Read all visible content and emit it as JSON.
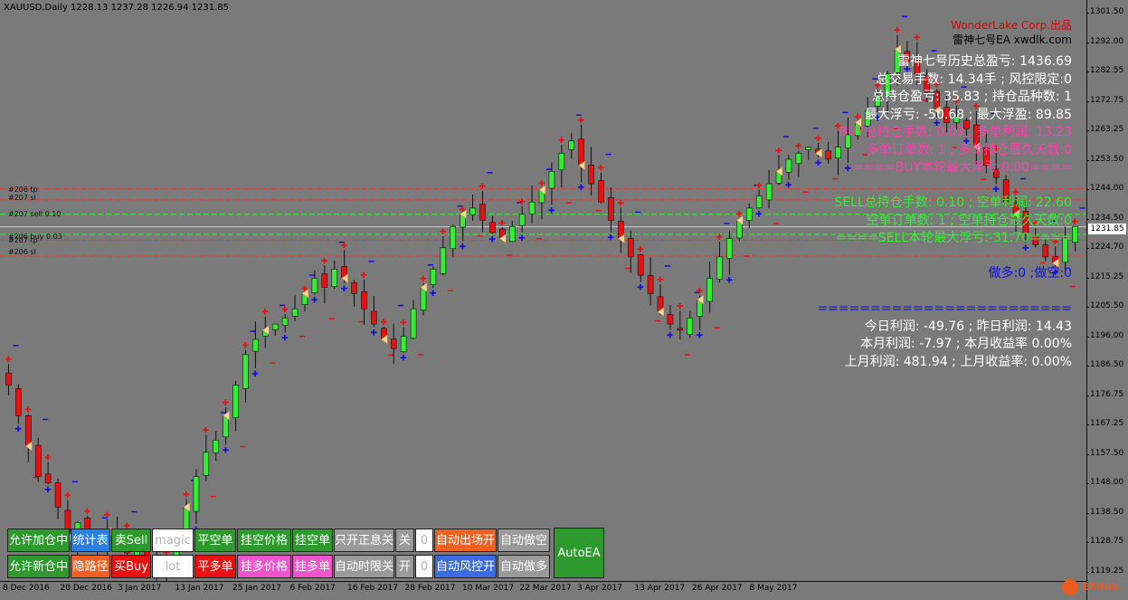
{
  "header": {
    "symbol_label": "XAUUSD,Daily",
    "ohlc": "1228.13 1237.28 1226.94 1231.85"
  },
  "brand": {
    "line1": "WonderLake Corp.出品",
    "line2": "雷神七号EA xwdlk.com"
  },
  "info_lines": [
    {
      "text": "雷神七号历史总盈亏: 1436.69",
      "color": "#ffffff"
    },
    {
      "text": "总交易手数: 14.34手 ; 风控限定:0",
      "color": "#ffffff"
    },
    {
      "text": "总持仓盈亏: 35.83 ; 持仓品种数: 1",
      "color": "#ffffff"
    },
    {
      "text": "最大浮亏: -50.68 ; 最大浮盈: 89.85",
      "color": "#ffffff"
    },
    {
      "text": "BUY总持仓手数: 0.03 ; 多单利润: 13.23",
      "color": "#ff3fb0"
    },
    {
      "text": "多单订单数: 1 ; 多单持仓最久天数:0",
      "color": "#ff3fb0"
    },
    {
      "text": "====BUY本轮最大浮亏:0.00====",
      "color": "#ff3fb0"
    },
    {
      "text": "",
      "color": "#ffffff"
    },
    {
      "text": "SELL总持仓手数: 0.10 ; 空单利润: 22.60",
      "color": "#33ee33"
    },
    {
      "text": "空单订单数: 1 ; 空单持仓最久天数:0",
      "color": "#33ee33"
    },
    {
      "text": "====SELL本轮最大浮亏:-31.70====",
      "color": "#33ee33"
    },
    {
      "text": "",
      "color": "#ffffff"
    },
    {
      "text": "做多:0 ;做空:0",
      "color": "#1010e0"
    },
    {
      "text": "",
      "color": "#ffffff"
    },
    {
      "text": "========================",
      "color": "#1010e0"
    },
    {
      "text": "今日利润: -49.76 ; 昨日利润: 14.43",
      "color": "#ffffff"
    },
    {
      "text": "本月利润: -7.97 ; 本月收益率 0.00%",
      "color": "#ffffff"
    },
    {
      "text": "上月利润: 481.94 ; 上月收益率: 0.00%",
      "color": "#ffffff"
    }
  ],
  "level_labels": [
    {
      "text": "#206 tp"
    },
    {
      "text": "#207 sl"
    },
    {
      "text": "#207 sell 0.10"
    },
    {
      "text": "#206 buy 0.03"
    },
    {
      "text": "#207 tp"
    },
    {
      "text": "#206 sl"
    }
  ],
  "price_axis": {
    "ticks": [
      "1301.50",
      "1292.00",
      "1282.55",
      "1272.75",
      "1263.25",
      "1253.50",
      "1244.00",
      "1234.50",
      "1224.70",
      "1215.25",
      "1205.50",
      "1196.00",
      "1186.50",
      "1176.75",
      "1167.25",
      "1157.50",
      "1148.00",
      "1138.50",
      "1128.75",
      "1119.25"
    ],
    "current_price": "1231.85"
  },
  "time_axis": [
    "8 Dec 2016",
    "20 Dec 2016",
    "3 Jan 2017",
    "13 Jan 2017",
    "25 Jan 2017",
    "6 Feb 2017",
    "16 Feb 2017",
    "28 Feb 2017",
    "10 Mar 2017",
    "22 Mar 2017",
    "3 Apr 2017",
    "13 Apr 2017",
    "26 Apr 2017",
    "8 May 2017"
  ],
  "buttons": [
    {
      "id": "allow-add",
      "label": "允许加仓中",
      "bg": "#2e9a2e",
      "fg": "#ffffff"
    },
    {
      "id": "stats",
      "label": "统计表",
      "bg": "#2a7fe0",
      "fg": "#ffffff"
    },
    {
      "id": "sell",
      "label": "卖Sell",
      "bg": "#2e9a2e",
      "fg": "#ffffff"
    },
    {
      "id": "magic",
      "label": "magic",
      "bg": "#ffffff",
      "fg": "#b0b0b0"
    },
    {
      "id": "close-short",
      "label": "平空单",
      "bg": "#2e9a2e",
      "fg": "#ffffff"
    },
    {
      "id": "pending-sell-price",
      "label": "挂空价格",
      "bg": "#2e9a2e",
      "fg": "#ffffff"
    },
    {
      "id": "pending-sell",
      "label": "挂空单",
      "bg": "#2e9a2e",
      "fg": "#ffffff"
    },
    {
      "id": "profit-only-close",
      "label": "只开正息关",
      "bg": "#9a9a9a",
      "fg": "#ffffff"
    },
    {
      "id": "toggle-off",
      "label": "关",
      "bg": "#9a9a9a",
      "fg": "#ffffff"
    },
    {
      "id": "toggle-off-val",
      "label": "0",
      "bg": "#ffffff",
      "fg": "#b0b0b0"
    },
    {
      "id": "auto-entry",
      "label": "自动出场开",
      "bg": "#f06020",
      "fg": "#ffffff"
    },
    {
      "id": "auto-short",
      "label": "自动做空",
      "bg": "#9a9a9a",
      "fg": "#ffffff"
    },
    {
      "id": "allow-new",
      "label": "允许新仓中",
      "bg": "#2e9a2e",
      "fg": "#ffffff"
    },
    {
      "id": "hide-path",
      "label": "隐路径",
      "bg": "#f06020",
      "fg": "#ffffff"
    },
    {
      "id": "buy",
      "label": "买Buy",
      "bg": "#e81010",
      "fg": "#ffffff"
    },
    {
      "id": "lot",
      "label": "lot",
      "bg": "#ffffff",
      "fg": "#b0b0b0"
    },
    {
      "id": "close-long",
      "label": "平多单",
      "bg": "#e81010",
      "fg": "#ffffff"
    },
    {
      "id": "pending-buy-price",
      "label": "挂多价格",
      "bg": "#ee55cc",
      "fg": "#ffffff"
    },
    {
      "id": "pending-buy",
      "label": "挂多单",
      "bg": "#ee55cc",
      "fg": "#ffffff"
    },
    {
      "id": "auto-time-limit",
      "label": "自动时限关",
      "bg": "#9a9a9a",
      "fg": "#ffffff"
    },
    {
      "id": "toggle-on",
      "label": "开",
      "bg": "#9a9a9a",
      "fg": "#ffffff"
    },
    {
      "id": "toggle-on-val",
      "label": "0",
      "bg": "#ffffff",
      "fg": "#b0b0b0"
    },
    {
      "id": "auto-risk",
      "label": "自动风控开",
      "bg": "#3a6be0",
      "fg": "#ffffff"
    },
    {
      "id": "auto-long",
      "label": "自动做多",
      "bg": "#9a9a9a",
      "fg": "#ffffff"
    },
    {
      "id": "auto-ea",
      "label": "AutoEA",
      "bg": "#2e9a2e",
      "fg": "#ffffff"
    }
  ],
  "watermark": {
    "text": "EAHub"
  },
  "colors": {
    "background": "#7a7a7a",
    "bull": "#33ee33",
    "bear": "#e81010",
    "tp_line": "#ff3030",
    "sl_line": "#ff3030",
    "sell_line": "#33ee33",
    "buy_line": "#33ee33",
    "price_line": "#cccccc"
  },
  "chart_data": {
    "type": "candlestick",
    "title": "XAUUSD,Daily",
    "ylim": [
      1117,
      1305
    ],
    "current_price": 1231.85,
    "closes": [
      1180,
      1170,
      1160,
      1150,
      1148,
      1140,
      1130,
      1135,
      1128,
      1126,
      1132,
      1130,
      1125,
      1128,
      1122,
      1118,
      1120,
      1128,
      1140,
      1150,
      1158,
      1162,
      1170,
      1180,
      1190,
      1195,
      1198,
      1200,
      1202,
      1205,
      1210,
      1215,
      1212,
      1218,
      1215,
      1210,
      1205,
      1200,
      1195,
      1192,
      1196,
      1205,
      1212,
      1218,
      1225,
      1232,
      1236,
      1238,
      1234,
      1230,
      1228,
      1232,
      1236,
      1240,
      1244,
      1250,
      1256,
      1260,
      1252,
      1246,
      1240,
      1234,
      1228,
      1222,
      1216,
      1210,
      1204,
      1200,
      1198,
      1202,
      1208,
      1215,
      1222,
      1228,
      1234,
      1238,
      1242,
      1246,
      1250,
      1254,
      1256,
      1258,
      1256,
      1254,
      1258,
      1262,
      1266,
      1270,
      1275,
      1282,
      1290,
      1286,
      1282,
      1276,
      1270,
      1266,
      1268,
      1264,
      1258,
      1252,
      1248,
      1240,
      1236,
      1230,
      1226,
      1222,
      1220,
      1228,
      1232
    ],
    "levels": [
      {
        "name": "#206 tp",
        "price": 1244.3,
        "color": "#ff3030"
      },
      {
        "name": "#207 sl",
        "price": 1240.7,
        "color": "#ff3030"
      },
      {
        "name": "#207 sell 0.10",
        "price": 1236.0,
        "color": "#33ee33"
      },
      {
        "name": "#206 buy 0.03",
        "price": 1229.4,
        "color": "#33ee33"
      },
      {
        "name": "#207 tp",
        "price": 1227.5,
        "color": "#ff3030"
      },
      {
        "name": "#206 sl",
        "price": 1222.3,
        "color": "#ff3030"
      }
    ]
  }
}
